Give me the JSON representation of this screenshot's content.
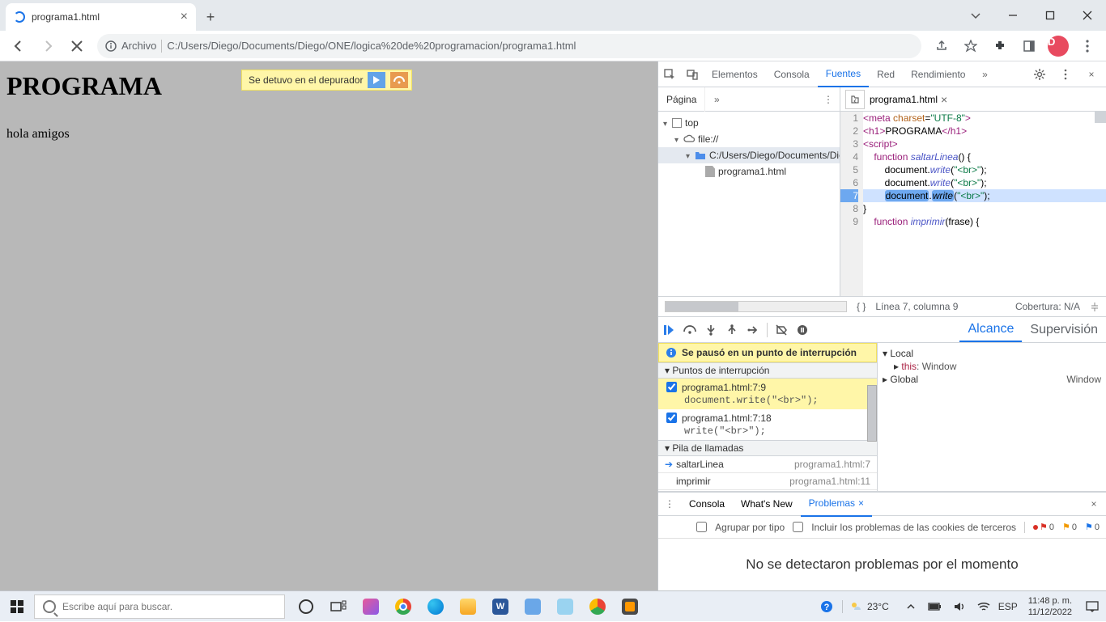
{
  "browser": {
    "tab_title": "programa1.html",
    "url_scheme": "Archivo",
    "url_path": "C:/Users/Diego/Documents/Diego/ONE/logica%20de%20programacion/programa1.html",
    "profile_initial": "D"
  },
  "page": {
    "heading": "PROGRAMA",
    "text": "hola amigos"
  },
  "overlay": {
    "text": "Se detuvo en el depurador"
  },
  "devtools": {
    "tabs": {
      "elementos": "Elementos",
      "consola": "Consola",
      "fuentes": "Fuentes",
      "red": "Red",
      "rendimiento": "Rendimiento"
    },
    "subtab": "Página",
    "open_file": "programa1.html",
    "tree": {
      "top": "top",
      "origin": "file://",
      "dir": "C:/Users/Diego/Documents/Die",
      "file": "programa1.html"
    },
    "code": {
      "l1": "<meta charset=\"UTF-8\">",
      "l2": "<h1>PROGRAMA</h1>",
      "l3": "<script>",
      "l4_kw": "function",
      "l4_fn": "saltarLinea",
      "l4_end": "() {",
      "lw_obj": "document",
      "lw_fn": "write",
      "lw_arg": "(\"<br>\");",
      "l8": "    }",
      "l9_kw": "function",
      "l9_fn": "imprimir",
      "l9_end": "(frase) {"
    },
    "status": {
      "position": "Línea 7, columna 9",
      "coverage": "Cobertura: N/A"
    },
    "scope_tabs": {
      "alcance": "Alcance",
      "supervision": "Supervisión"
    },
    "scope": {
      "local": "Local",
      "this_k": "this",
      "this_v": ": Window",
      "global_k": "Global",
      "global_v": "Window"
    },
    "banner": "Se pausó en un punto de interrupción",
    "breakpoints_title": "Puntos de interrupción",
    "bp1": {
      "title": "programa1.html:7:9",
      "code": "document.write(\"<br>\");"
    },
    "bp2": {
      "title": "programa1.html:7:18",
      "code": "write(\"<br>\");"
    },
    "callstack_title": "Pila de llamadas",
    "call1": {
      "name": "saltarLinea",
      "loc": "programa1.html:7"
    },
    "call2": {
      "name": "imprimir",
      "loc": "programa1.html:11"
    },
    "drawer": {
      "consola": "Consola",
      "whatsnew": "What's New",
      "problemas": "Problemas"
    },
    "problems": {
      "group": "Agrupar por tipo",
      "cookies": "Incluir los problemas de las cookies de terceros",
      "none": "No se detectaron problemas por el momento",
      "count": "0"
    }
  },
  "taskbar": {
    "search_placeholder": "Escribe aquí para buscar.",
    "temp": "23°C",
    "lang": "ESP",
    "time": "11:48 p. m.",
    "date": "11/12/2022"
  }
}
